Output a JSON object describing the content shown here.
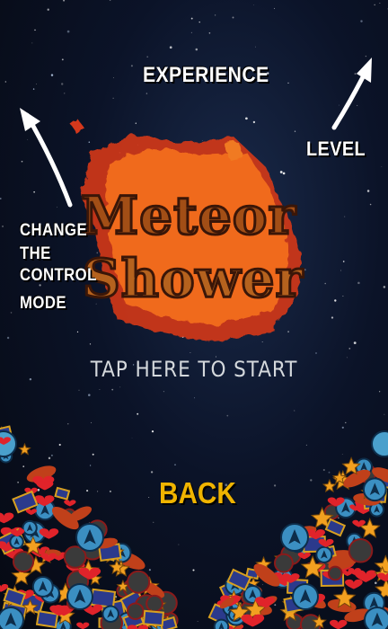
{
  "labels": {
    "experience": "EXPERIENCE",
    "level": "LEVEL",
    "change_control_lines": [
      "CHANGE",
      "THE",
      "CONTROL",
      "MODE"
    ]
  },
  "logo": {
    "line1": "Meteor",
    "line2": "Shower"
  },
  "start_prompt": "TAP HERE TO START",
  "back_button": "BACK",
  "colors": {
    "background": "#070b16",
    "back": "#f0b400",
    "logo_fill": "#b0561a",
    "logo_glow": "#e04a18"
  },
  "icons": [
    "arrow-pointer-icon",
    "heart-icon",
    "star-icon",
    "ship-icon",
    "skull-icon"
  ]
}
